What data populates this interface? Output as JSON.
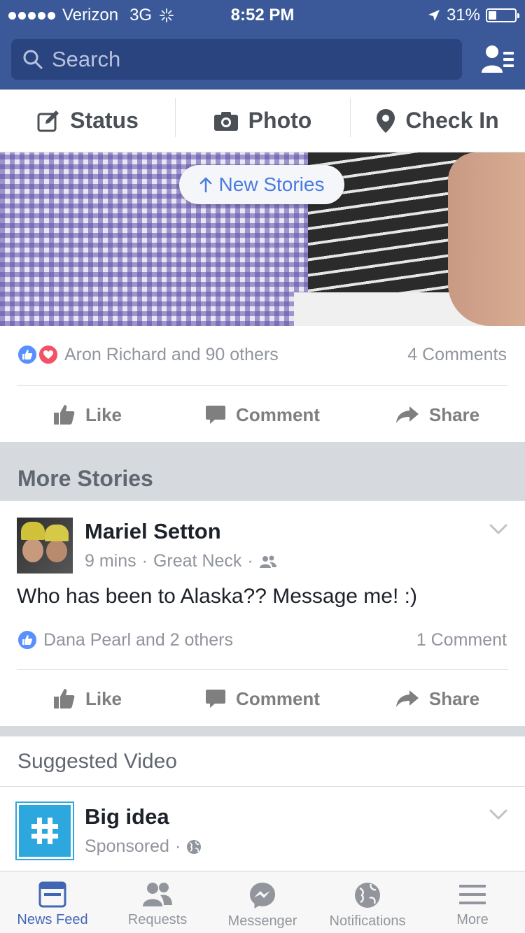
{
  "status_bar": {
    "carrier": "Verizon",
    "network": "3G",
    "time": "8:52 PM",
    "battery": "31%",
    "battery_level": 0.31
  },
  "header": {
    "search_placeholder": "Search"
  },
  "composer": {
    "status_label": "Status",
    "photo_label": "Photo",
    "checkin_label": "Check In"
  },
  "feed": {
    "new_stories_label": "New Stories",
    "first_post": {
      "reactions_text": "Aron Richard and 90 others",
      "comments_text": "4 Comments"
    },
    "actions": {
      "like": "Like",
      "comment": "Comment",
      "share": "Share"
    },
    "more_stories_title": "More Stories",
    "post": {
      "author": "Mariel Setton",
      "time": "9 mins",
      "location": "Great Neck",
      "text": "Who has been to Alaska?? Message me! :)",
      "reactions_text": "Dana Pearl and 2 others",
      "comments_text": "1 Comment"
    },
    "suggested": {
      "title": "Suggested Video",
      "name": "Big idea",
      "sub": "Sponsored"
    }
  },
  "tabs": [
    {
      "label": "News Feed",
      "icon": "news-feed-icon",
      "active": true
    },
    {
      "label": "Requests",
      "icon": "friend-requests-icon",
      "active": false
    },
    {
      "label": "Messenger",
      "icon": "messenger-icon",
      "active": false
    },
    {
      "label": "Notifications",
      "icon": "globe-icon",
      "active": false
    },
    {
      "label": "More",
      "icon": "menu-icon",
      "active": false
    }
  ],
  "colors": {
    "brand": "#3b5998",
    "accent_blue": "#4267b2",
    "like_blue": "#5890ff",
    "love_red": "#f25268"
  }
}
